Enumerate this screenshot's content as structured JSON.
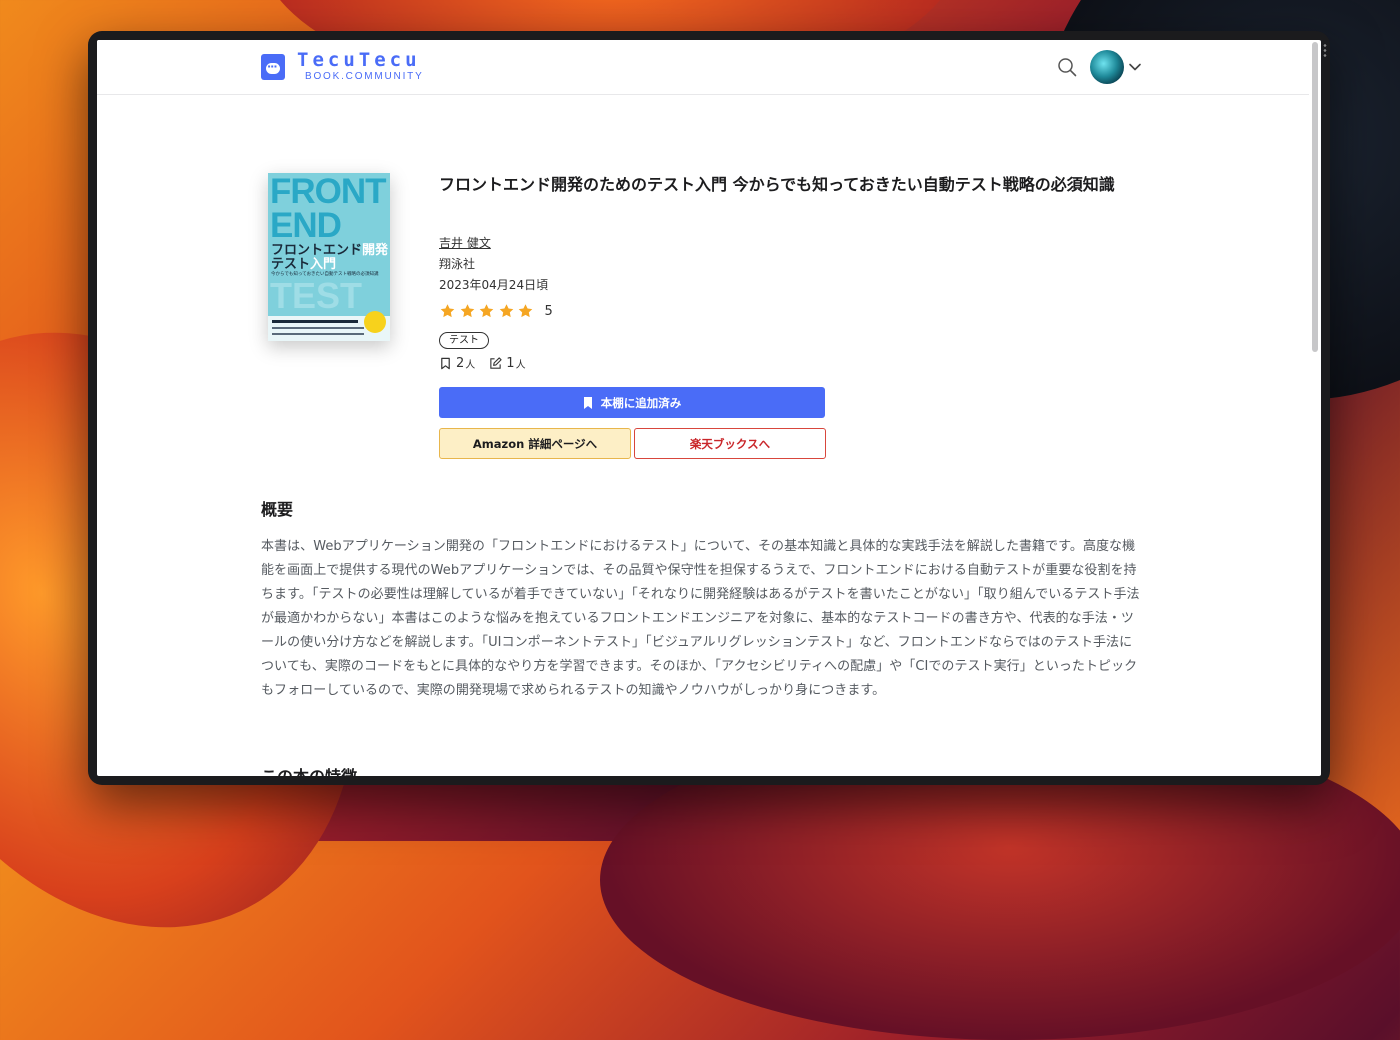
{
  "site": {
    "logo_title": "TecuTecu",
    "logo_subtitle": "BOOK.COMMUNITY"
  },
  "header": {
    "search_icon": "search-icon",
    "avatar_icon": "avatar",
    "menu_icon": "chevron-down-icon"
  },
  "book": {
    "cover": {
      "front_text": "FRONT END",
      "title_line1": "フロントエンド",
      "title_accent1": "開発",
      "title_line2": "テスト",
      "title_accent2": "入門",
      "subtitle": "今からでも知っておきたい自動テスト戦略の必須知識",
      "test_text": "TEST"
    },
    "title": "フロントエンド開発のためのテスト入門 今からでも知っておきたい自動テスト戦略の必須知識",
    "author": "吉井 健文",
    "publisher": "翔泳社",
    "published_date": "2023年04月24日頃",
    "rating": {
      "stars": 5,
      "value_label": "5"
    },
    "tag": "テスト",
    "stats": {
      "bookmarks": "2",
      "bookmarks_unit": "人",
      "reviews": "1",
      "reviews_unit": "人"
    }
  },
  "actions": {
    "shelf_label": "本棚に追加済み",
    "amazon_label": "Amazon 詳細ページへ",
    "rakuten_label": "楽天ブックスへ"
  },
  "overview": {
    "heading": "概要",
    "body": "本書は、Webアプリケーション開発の「フロントエンドにおけるテスト」について、その基本知識と具体的な実践手法を解説した書籍です。高度な機能を画面上で提供する現代のWebアプリケーションでは、その品質や保守性を担保するうえで、フロントエンドにおける自動テストが重要な役割を持ちます。「テストの必要性は理解しているが着手できていない」「それなりに開発経験はあるがテストを書いたことがない」「取り組んでいるテスト手法が最適かわからない」本書はこのような悩みを抱えているフロントエンドエンジニアを対象に、基本的なテストコードの書き方や、代表的な手法・ツールの使い分け方などを解説します。「UIコンポーネントテスト」「ビジュアルリグレッションテスト」など、フロントエンドならではのテスト手法についても、実際のコードをもとに具体的なやり方を学習できます。そのほか、「アクセシビリティへの配慮」や「CIでのテスト実行」といったトピックもフォローしているので、実際の開発現場で求められるテストの知識やノウハウがしっかり身につきます。"
  },
  "features": {
    "heading": "この本の特徴"
  },
  "colors": {
    "accent": "#4a6cf7",
    "star": "#f5a623",
    "amazon_bg": "#fdefc6",
    "rakuten": "#c9262a"
  }
}
